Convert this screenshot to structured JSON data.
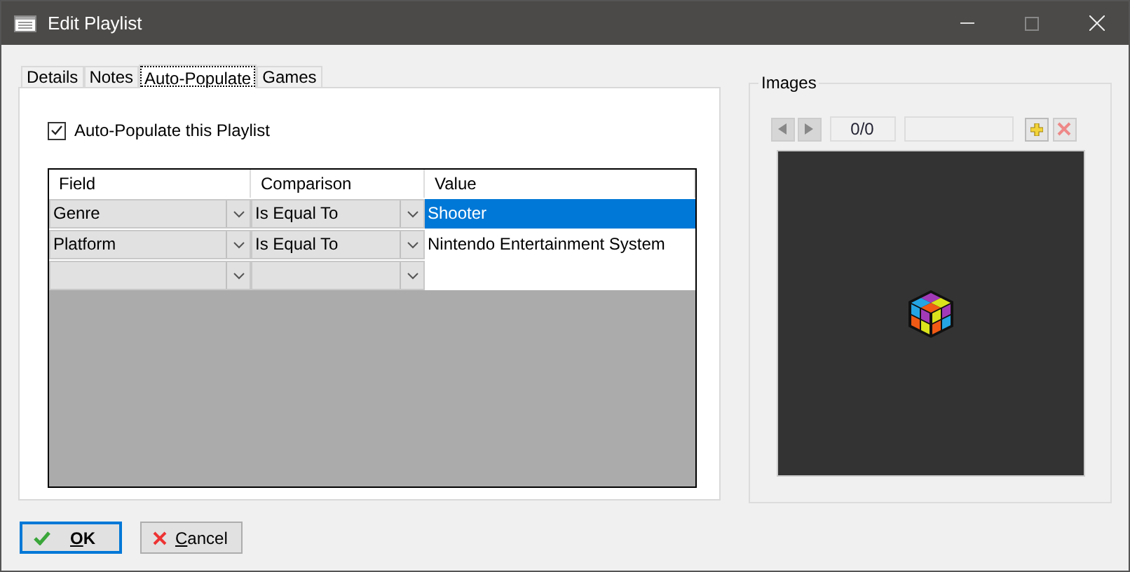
{
  "window": {
    "title": "Edit Playlist"
  },
  "tabs": [
    {
      "label": "Details",
      "selected": false
    },
    {
      "label": "Notes",
      "selected": false
    },
    {
      "label": "Auto-Populate",
      "selected": true
    },
    {
      "label": "Games",
      "selected": false
    }
  ],
  "auto_populate": {
    "label": "Auto-Populate this Playlist",
    "checked": true
  },
  "grid": {
    "columns": [
      "Field",
      "Comparison",
      "Value"
    ],
    "rows": [
      {
        "field": "Genre",
        "comparison": "Is Equal To",
        "value": "Shooter",
        "selected": true
      },
      {
        "field": "Platform",
        "comparison": "Is Equal To",
        "value": "Nintendo Entertainment System",
        "selected": false
      },
      {
        "selected": false
      }
    ]
  },
  "images": {
    "title": "Images",
    "counter": "0/0"
  },
  "buttons": [
    {
      "kind": "ok",
      "label": "OK",
      "default": true
    },
    {
      "kind": "cancel",
      "label": "Cancel",
      "default": false
    }
  ]
}
